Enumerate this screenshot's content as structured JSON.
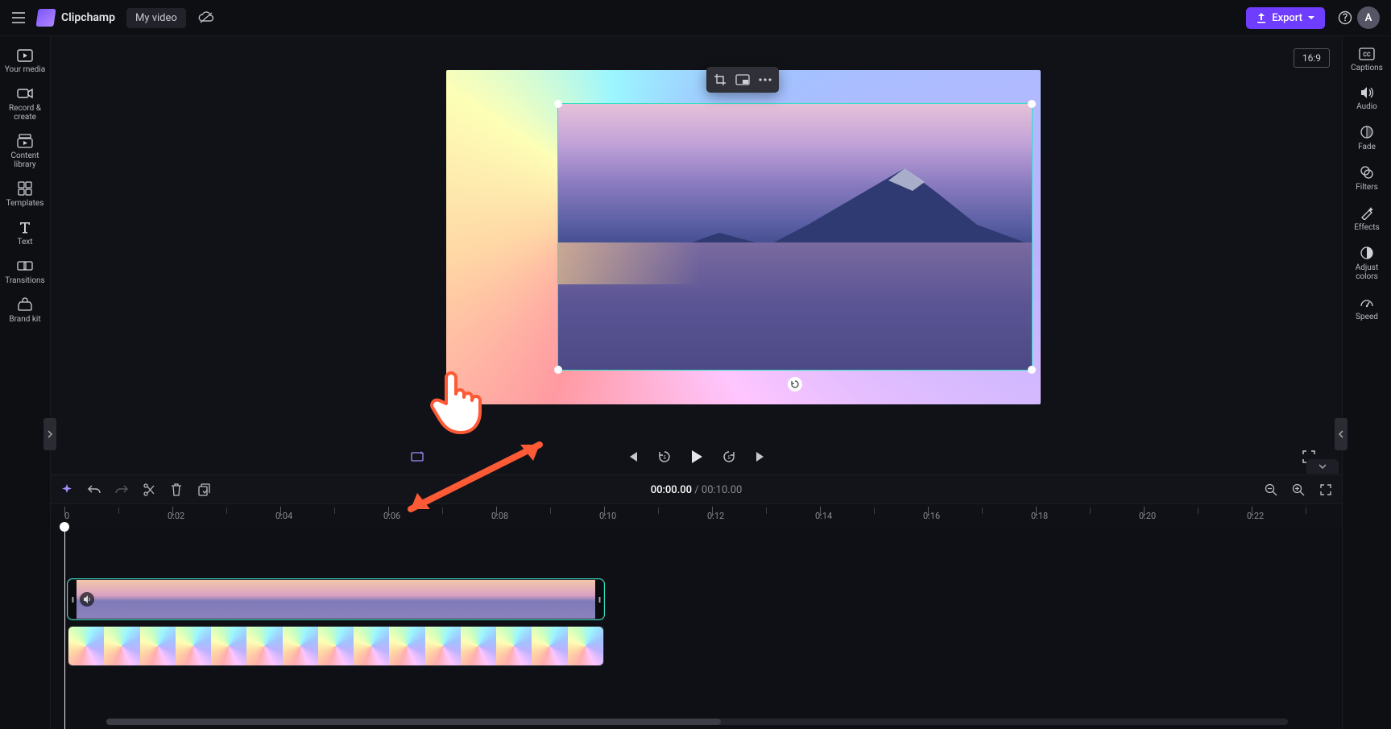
{
  "header": {
    "app_name": "Clipchamp",
    "project_name": "My video",
    "export_label": "Export",
    "avatar_initial": "A"
  },
  "left_nav": {
    "items": [
      {
        "label": "Your media",
        "icon": "media"
      },
      {
        "label": "Record & create",
        "icon": "record"
      },
      {
        "label": "Content library",
        "icon": "library"
      },
      {
        "label": "Templates",
        "icon": "templates"
      },
      {
        "label": "Text",
        "icon": "text"
      },
      {
        "label": "Transitions",
        "icon": "transitions"
      },
      {
        "label": "Brand kit",
        "icon": "brand"
      }
    ]
  },
  "right_nav": {
    "items": [
      {
        "label": "Captions"
      },
      {
        "label": "Audio"
      },
      {
        "label": "Fade"
      },
      {
        "label": "Filters"
      },
      {
        "label": "Effects"
      },
      {
        "label": "Adjust colors"
      },
      {
        "label": "Speed"
      }
    ]
  },
  "stage": {
    "aspect_label": "16:9",
    "float_actions": [
      "crop",
      "pip",
      "more"
    ]
  },
  "playback": {
    "current": "00:00.00",
    "sep": " / ",
    "duration": "00:10.00"
  },
  "ruler": {
    "labels": [
      "0",
      "0:02",
      "0:04",
      "0:06",
      "0:08",
      "0:10",
      "0:12",
      "0:14",
      "0:16",
      "0:18",
      "0:20",
      "0:22"
    ]
  },
  "annotation": {
    "hint": "drag-corner-to-resize"
  }
}
